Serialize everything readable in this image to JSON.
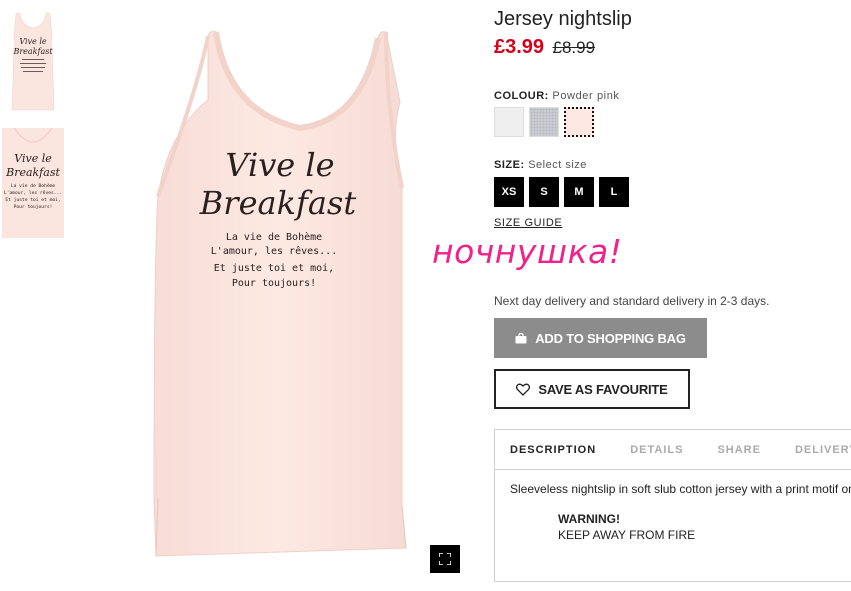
{
  "thumbnails": [
    {
      "print_line1": "Vive le",
      "print_line2": "Breakfast"
    },
    {
      "print_line1": "Vive le",
      "print_line2": "Breakfast",
      "small_lines": [
        "La vie de Bohème",
        "L'amour, les rêves...",
        "Et juste toi et moi,",
        "Pour toujours!"
      ]
    }
  ],
  "main_image": {
    "print_title_line1": "Vive le",
    "print_title_line2": "Breakfast",
    "print_lines": [
      "La vie de Bohème",
      "L'amour, les rêves...",
      "Et juste toi et moi,",
      "Pour toujours!"
    ],
    "garment_color": "#fbe5df",
    "expand_icon": "expand-icon"
  },
  "product": {
    "title": "Jersey nightslip",
    "price_now": "£3.99",
    "price_old": "£8.99",
    "colour_label": "COLOUR:",
    "colour_value": "Powder pink",
    "colours": [
      {
        "name": "white",
        "hex": "#efeff0"
      },
      {
        "name": "grey marl",
        "hex": "#c9ccd0"
      },
      {
        "name": "powder pink",
        "hex": "#fde8e3",
        "selected": true
      }
    ],
    "size_label": "SIZE:",
    "size_value": "Select size",
    "sizes": [
      "XS",
      "S",
      "M",
      "L"
    ],
    "size_guide": "SIZE GUIDE",
    "annotation": "ночнушка!",
    "delivery_note": "Next day delivery and standard delivery in 2-3 days.",
    "add_to_bag": "ADD TO SHOPPING BAG",
    "save_favourite": "SAVE AS FAVOURITE"
  },
  "tabs": {
    "items": [
      "DESCRIPTION",
      "DETAILS",
      "SHARE",
      "DELIVERY"
    ],
    "active": "DESCRIPTION",
    "description": "Sleeveless nightslip in soft slub cotton jersey with a print motif on",
    "warning_title": "WARNING!",
    "warning_text": "KEEP AWAY FROM FIRE"
  },
  "colors": {
    "price_red": "#d6001c",
    "button_grey": "#8c8c8c",
    "annotation_pink": "#f0238a"
  }
}
